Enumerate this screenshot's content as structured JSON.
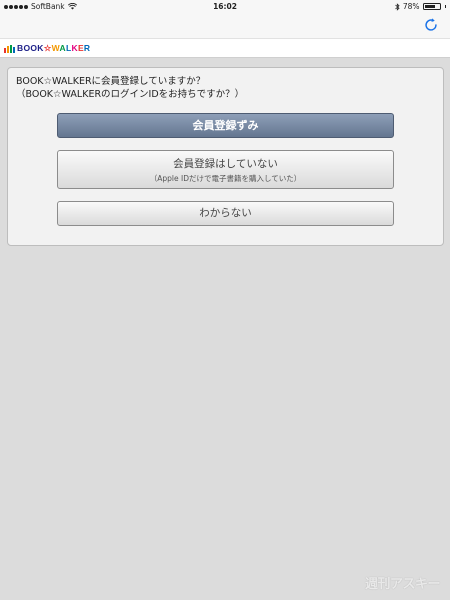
{
  "status_bar": {
    "carrier": "SoftBank",
    "time": "16:02",
    "battery_percent": "78%",
    "battery_level": 0.78
  },
  "logo": {
    "text": "BOOK☆WALKER"
  },
  "question": {
    "line1": "BOOK☆WALKERに会員登録していますか？",
    "line2": "（BOOK☆WALKERのログインIDをお持ちですか？）"
  },
  "buttons": {
    "registered": "会員登録ずみ",
    "not_registered": "会員登録はしていない",
    "not_registered_note": "（Apple IDだけで電子書籍を購入していた）",
    "unknown": "わからない"
  },
  "watermark": "週刊アスキー",
  "colors": {
    "primary_button": "#647690",
    "refresh_icon": "#1a73e8",
    "background": "#dcdcdc"
  }
}
